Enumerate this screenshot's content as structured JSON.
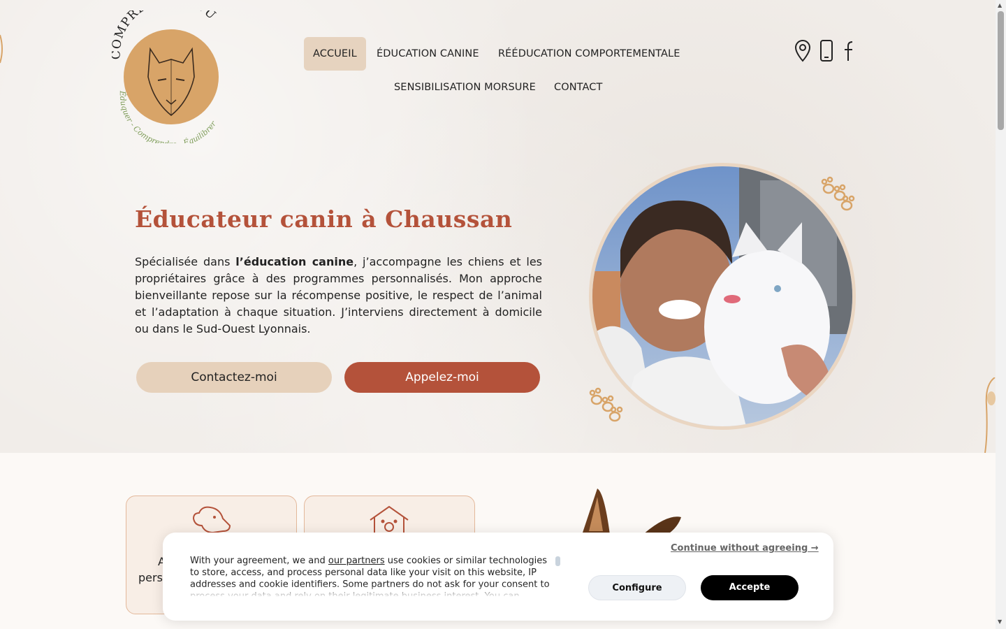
{
  "brand": {
    "name": "COMPRENTOUTOU",
    "tagline": "Éduquer - Comprendre - Équilibrer"
  },
  "nav": {
    "items": [
      {
        "label": "ACCUEIL",
        "active": true
      },
      {
        "label": "ÉDUCATION CANINE"
      },
      {
        "label": "RÉÉDUCATION COMPORTEMENTALE"
      },
      {
        "label": "SENSIBILISATION MORSURE"
      },
      {
        "label": "CONTACT"
      }
    ],
    "icons": [
      "location-pin-icon",
      "mobile-phone-icon",
      "facebook-icon"
    ]
  },
  "hero": {
    "title": "Éducateur canin à Chaussan",
    "text_before": "Spécialisée dans ",
    "text_bold": "l’éducation canine",
    "text_after": ", j’accompagne les chiens et les propriétaires grâce à des programmes personnalisés. Mon approche bienveillante repose sur la récompense positive, le respect de l’animal et l’adaptation à chaque situation. J’interviens directement à domicile ou dans le Sud-Ouest Lyonnais.",
    "btn_contact": "Contactez-moi",
    "btn_call": "Appelez-moi"
  },
  "cards": {
    "card1_partial_a": "A",
    "card1_partial_b": "pers"
  },
  "cookie": {
    "continue": "Continue without agreeing →",
    "text_a": "With your agreement, we and ",
    "partners_link": "our partners",
    "text_b": " use cookies or similar technologies to store, access, and process personal data like your visit on this website, IP addresses and cookie identifiers. Some partners do not ask for your consent to process your data and rely on their legitimate business interest. You can",
    "configure": "Configure",
    "accept": "Accepte"
  },
  "colors": {
    "accent": "#b4523a",
    "beige": "#e6d1bb",
    "logo_gold": "#d8a468",
    "tagline_green": "#7f9d5a"
  }
}
